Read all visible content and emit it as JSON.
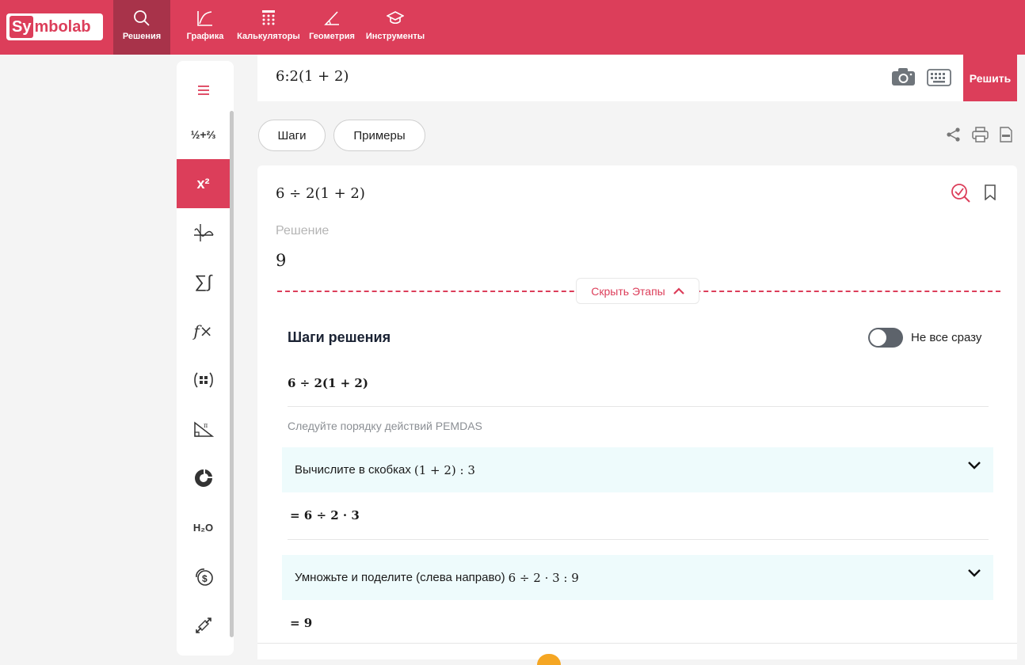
{
  "header": {
    "logo_prefix": "Sy",
    "logo_rest": "mbolab",
    "nav": [
      {
        "label": "Решения",
        "icon": "search-icon",
        "active": true
      },
      {
        "label": "Графика",
        "icon": "graph-icon"
      },
      {
        "label": "Калькуляторы",
        "icon": "calculator-icon"
      },
      {
        "label": "Геометрия",
        "icon": "angle-icon"
      },
      {
        "label": "Инструменты",
        "icon": "graduation-cap-icon"
      }
    ]
  },
  "sidebar": {
    "items": [
      {
        "icon": "menu-icon"
      },
      {
        "icon": "fractions-icon",
        "text": "½+⅔"
      },
      {
        "icon": "algebra-icon",
        "text": "x²",
        "active": true
      },
      {
        "icon": "functions-graph-icon"
      },
      {
        "icon": "sum-integral-icon",
        "text": "∑∫"
      },
      {
        "icon": "function-icon",
        "text": "f×"
      },
      {
        "icon": "matrix-icon"
      },
      {
        "icon": "trigonometry-icon"
      },
      {
        "icon": "statistics-icon"
      },
      {
        "icon": "chemistry-icon",
        "text": "H₂O"
      },
      {
        "icon": "finance-icon"
      },
      {
        "icon": "conversions-icon"
      }
    ]
  },
  "input": {
    "expression": "6:2(1 + 2)",
    "solve_label": "Решить"
  },
  "tabs": {
    "steps": "Шаги",
    "examples": "Примеры"
  },
  "solution": {
    "problem": "6 ÷  2(1 + 2)",
    "label": "Решение",
    "value": "9",
    "hide_steps": "Скрыть Этапы",
    "steps_title": "Шаги решения",
    "toggle_label": "Не все сразу",
    "step_expression": "6 ÷  2(1 + 2)",
    "rule": "Следуйте порядку действий PEMDAS",
    "steps": [
      {
        "text": "Вычислите в скобках ",
        "math": "(1 + 2) :    3",
        "result": "= 6 ÷  2 ·  3"
      },
      {
        "text": "Умножьте и поделите (слева направо) ",
        "math": "6 ÷  2 ·  3 :    9",
        "result": "= 9"
      }
    ]
  },
  "colors": {
    "brand": "#dc3e5a",
    "step_bg": "#eefbfc"
  }
}
